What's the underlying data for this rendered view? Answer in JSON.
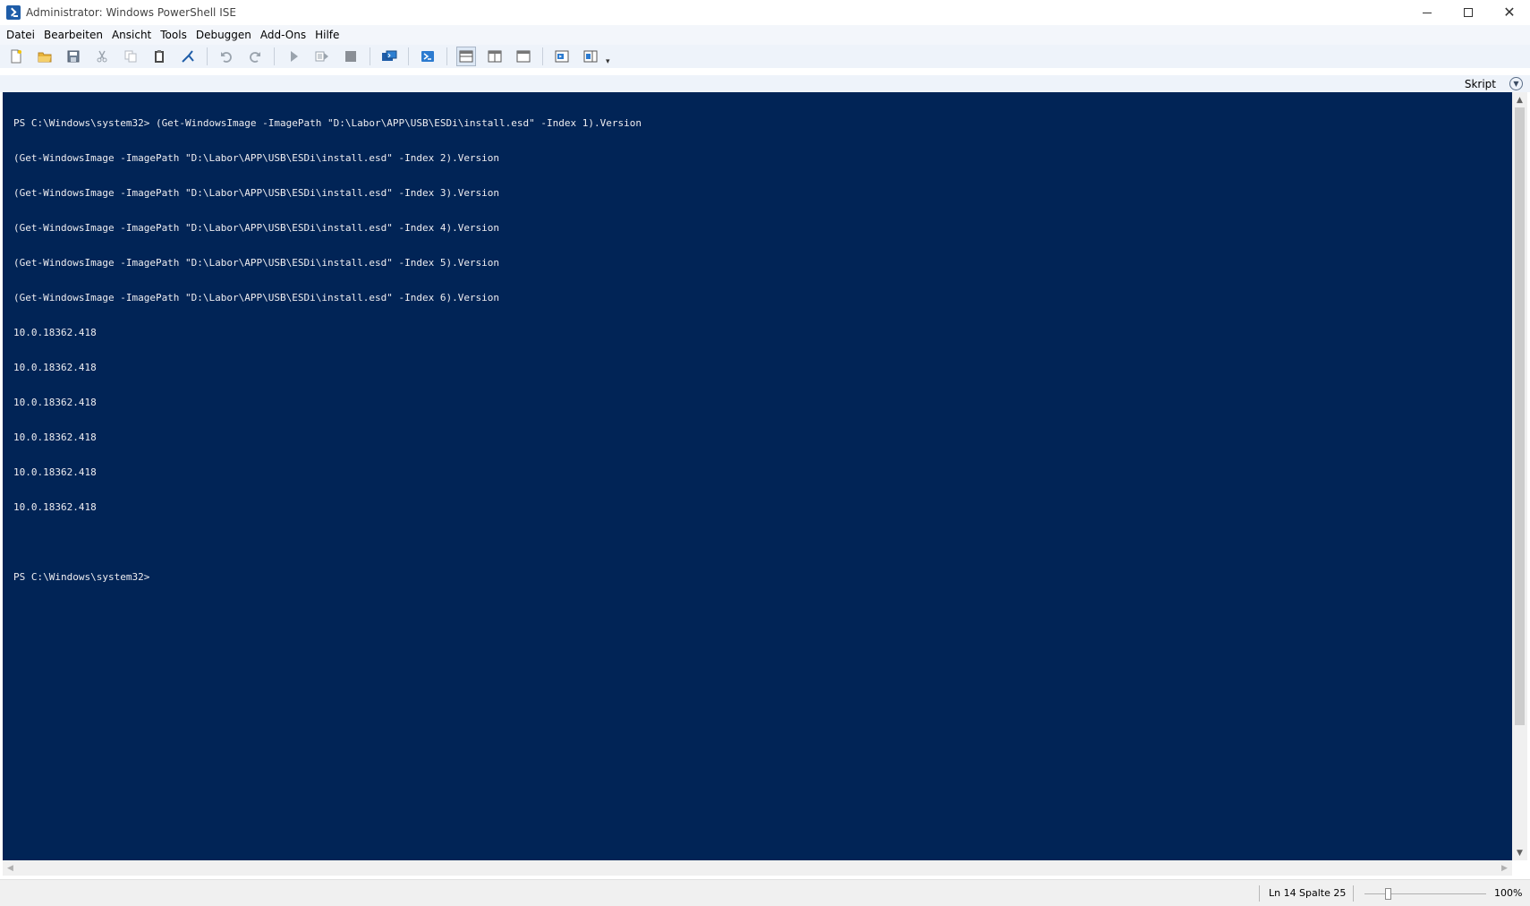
{
  "window": {
    "title": "Administrator: Windows PowerShell ISE",
    "app_icon": "powershell-ise-icon",
    "controls": {
      "minimize": "minimize-icon",
      "maximize": "maximize-icon",
      "close": "close-icon"
    }
  },
  "menu": {
    "items": [
      "Datei",
      "Bearbeiten",
      "Ansicht",
      "Tools",
      "Debuggen",
      "Add-Ons",
      "Hilfe"
    ]
  },
  "toolbar": {
    "icons": [
      "new-file-icon",
      "open-folder-icon",
      "save-icon",
      "cut-icon",
      "copy-icon",
      "paste-icon",
      "clear-console-icon",
      "undo-icon",
      "redo-icon",
      "run-script-icon",
      "run-selection-icon",
      "stop-icon",
      "new-remote-tab-icon",
      "start-powershell-icon",
      "show-script-pane-top-icon",
      "show-script-pane-right-icon",
      "show-script-pane-maximized-icon",
      "show-command-window-icon",
      "show-command-addon-icon"
    ],
    "accent_blue": "#1f5da8"
  },
  "script_bar": {
    "label": "Skript",
    "toggle_icon": "chevron-down-circle-icon"
  },
  "console": {
    "background": "#012456",
    "foreground": "#eeedf0",
    "lines": [
      "PS C:\\Windows\\system32> (Get-WindowsImage -ImagePath \"D:\\Labor\\APP\\USB\\ESDi\\install.esd\" -Index 1).Version",
      "(Get-WindowsImage -ImagePath \"D:\\Labor\\APP\\USB\\ESDi\\install.esd\" -Index 2).Version",
      "(Get-WindowsImage -ImagePath \"D:\\Labor\\APP\\USB\\ESDi\\install.esd\" -Index 3).Version",
      "(Get-WindowsImage -ImagePath \"D:\\Labor\\APP\\USB\\ESDi\\install.esd\" -Index 4).Version",
      "(Get-WindowsImage -ImagePath \"D:\\Labor\\APP\\USB\\ESDi\\install.esd\" -Index 5).Version",
      "(Get-WindowsImage -ImagePath \"D:\\Labor\\APP\\USB\\ESDi\\install.esd\" -Index 6).Version",
      "10.0.18362.418",
      "10.0.18362.418",
      "10.0.18362.418",
      "10.0.18362.418",
      "10.0.18362.418",
      "10.0.18362.418",
      "",
      "PS C:\\Windows\\system32>"
    ]
  },
  "status": {
    "line": "Ln 14",
    "column": "Spalte 25",
    "zoom": "100%"
  }
}
